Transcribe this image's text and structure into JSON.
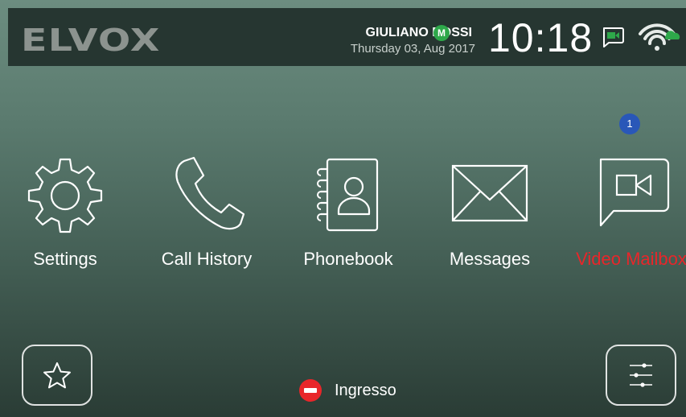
{
  "topbar": {
    "logo": "ELVOX",
    "user_name": "GIULIANO ROSSI",
    "user_badge": "M",
    "date": "Thursday 03, Aug 2017",
    "time": "10:18",
    "icons": [
      "video-message-icon",
      "wifi-cloud-icon"
    ]
  },
  "menu": {
    "items": [
      {
        "label": "Settings",
        "icon": "gear-icon"
      },
      {
        "label": "Call History",
        "icon": "phone-icon"
      },
      {
        "label": "Phonebook",
        "icon": "phonebook-icon"
      },
      {
        "label": "Messages",
        "icon": "envelope-icon"
      },
      {
        "label": "Video Mailbox",
        "icon": "video-chat-icon",
        "color": "#e8262a",
        "badge": "1"
      }
    ]
  },
  "footer": {
    "favorites_icon": "star-icon",
    "entrance_label": "Ingresso",
    "entrance_icon": "no-entry-icon",
    "settings_icon": "sliders-icon"
  },
  "colors": {
    "topbar_bg": "#263631",
    "accent_red": "#e8262a",
    "badge_blue": "#2957b8",
    "status_green": "#2ea84a"
  }
}
